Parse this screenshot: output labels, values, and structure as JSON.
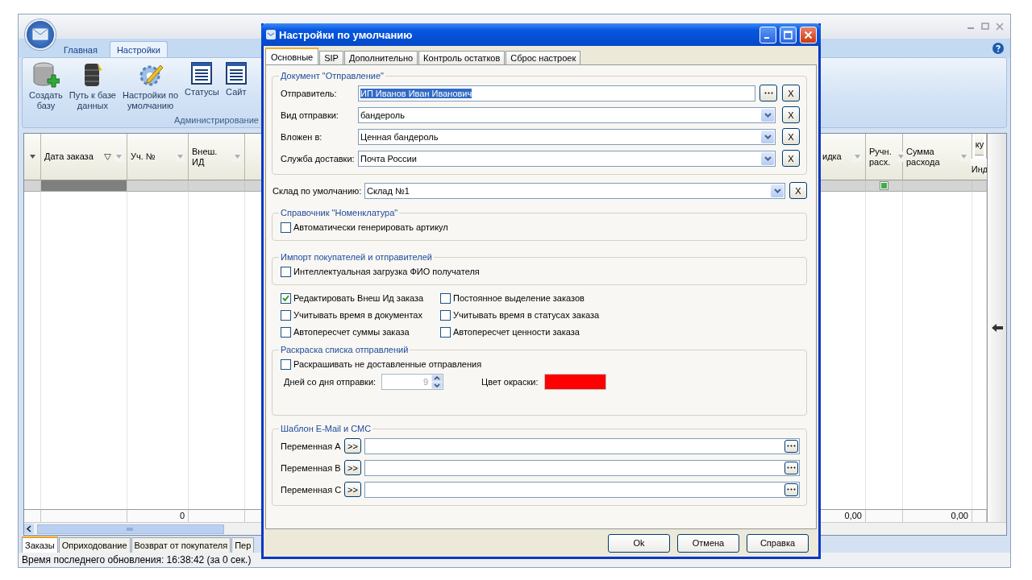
{
  "main_window": {
    "ribbon_tabs": [
      {
        "label": "Главная",
        "selected": false
      },
      {
        "label": "Настройки",
        "selected": true
      }
    ],
    "ribbon_buttons": [
      {
        "label": "Создать\nбазу"
      },
      {
        "label": "Путь к базе\nданных"
      },
      {
        "label": "Настройки по\nумолчанию"
      },
      {
        "label": "Статусы"
      },
      {
        "label": "Сайт"
      }
    ],
    "ribbon_group": "Администрирование",
    "table": {
      "columns_left": [
        {
          "label": "Дата заказа",
          "filtered": true
        },
        {
          "label": "Уч. №",
          "filtered": false,
          "total": "0"
        },
        {
          "label": "Внеш. ИД",
          "filtered": false
        }
      ],
      "columns_right": [
        {
          "label": "идка",
          "total": "0,00"
        },
        {
          "label": "Ручн.\nрасх."
        },
        {
          "label": "Сумма\nрасхода",
          "total": "0,00"
        }
      ],
      "column_cut": {
        "top": "ку",
        "bottom": "Инд"
      },
      "filter_checked": true
    },
    "bottom_tabs": [
      {
        "label": "Заказы",
        "selected": true
      },
      {
        "label": "Оприходование",
        "selected": false
      },
      {
        "label": "Возврат от покупателя",
        "selected": false
      },
      {
        "label": "Пер",
        "selected": false
      }
    ],
    "status_bar": "Время последнего обновления: 16:38:42 (за 0 сек.)"
  },
  "dialog": {
    "title": "Настройки по умолчанию",
    "tabs": [
      {
        "label": "Основные",
        "selected": true
      },
      {
        "label": "SIP",
        "selected": false
      },
      {
        "label": "Дополнительно",
        "selected": false
      },
      {
        "label": "Контроль остатков",
        "selected": false
      },
      {
        "label": "Сброс настроек",
        "selected": false
      }
    ],
    "document": {
      "legend": "Документ \"Отправление\"",
      "rows": [
        {
          "label": "Отправитель:",
          "value": "ИП Иванов Иван Иванович",
          "kind": "browse",
          "text_selected": true,
          "clear": "X"
        },
        {
          "label": "Вид отправки:",
          "value": "бандероль",
          "kind": "dropdown",
          "text_selected": false,
          "clear": "X"
        },
        {
          "label": "Вложен в:",
          "value": "Ценная бандероль",
          "kind": "dropdown",
          "text_selected": false,
          "clear": "X"
        },
        {
          "label": "Служба доставки:",
          "value": "Почта России",
          "kind": "dropdown",
          "text_selected": false,
          "clear": "X"
        }
      ]
    },
    "warehouse": {
      "label": "Склад по умолчанию:",
      "value": "Склад №1",
      "clear": "X"
    },
    "nomenclature": {
      "legend": "Справочник \"Номенклатура\"",
      "checkbox": {
        "label": "Автоматически генерировать артикул",
        "checked": false
      }
    },
    "import": {
      "legend": "Импорт покупателей и отправителей",
      "checkbox": {
        "label": "Интеллектуальная загрузка ФИО получателя",
        "checked": false
      }
    },
    "options": [
      {
        "label": "Редактировать Внеш Ид заказа",
        "checked": true
      },
      {
        "label": "Постоянное выделение заказов",
        "checked": false
      },
      {
        "label": "Учитывать время в документах",
        "checked": false
      },
      {
        "label": "Учитывать время в статусах заказа",
        "checked": false
      },
      {
        "label": "Автопересчет суммы заказа",
        "checked": false
      },
      {
        "label": "Автопересчет ценности заказа",
        "checked": false
      }
    ],
    "coloring": {
      "legend": "Раскраска списка отправлений",
      "checkbox": {
        "label": "Раскрашивать не доставленные отправления",
        "checked": false
      },
      "days_label": "Дней со дня отправки:",
      "days": {
        "value": "9",
        "disabled": true
      },
      "color_label": "Цвет окраски:",
      "color": "#ff0000"
    },
    "template": {
      "legend": "Шаблон E-Mail и СМС",
      "variables": [
        {
          "label": "Переменная A",
          "insert": ">>"
        },
        {
          "label": "Переменная B",
          "insert": ">>"
        },
        {
          "label": "Переменная C",
          "insert": ">>"
        }
      ]
    },
    "buttons": [
      "Ok",
      "Отмена",
      "Справка"
    ]
  }
}
